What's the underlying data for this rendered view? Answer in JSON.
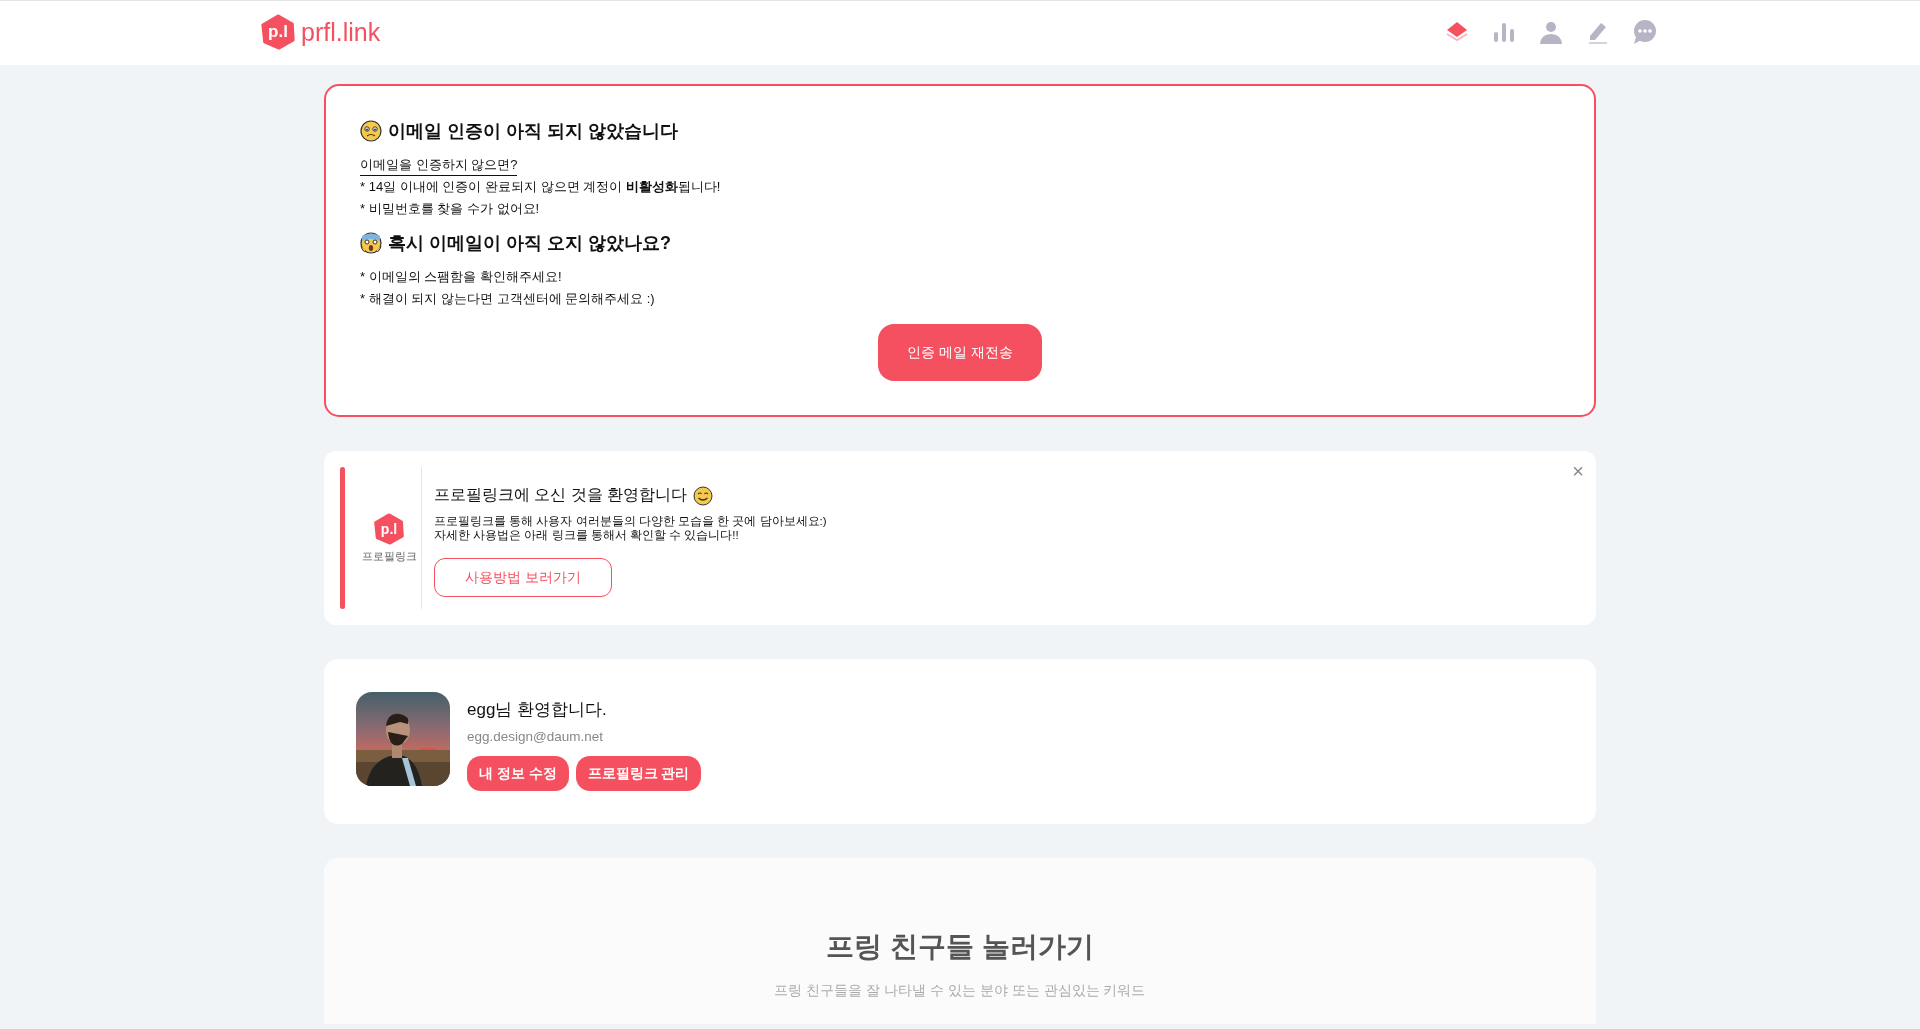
{
  "header": {
    "logo_mark": "p.l",
    "logo_text": "prfl.link",
    "nav": [
      {
        "kind": "layers",
        "selected": true
      },
      {
        "kind": "chart",
        "selected": false
      },
      {
        "kind": "user",
        "selected": false
      },
      {
        "kind": "edit",
        "selected": false
      },
      {
        "kind": "chat",
        "selected": false
      }
    ]
  },
  "verification_notice": {
    "title": "이메일 인증이 아직 되지 않았습니다",
    "subtitle": "이메일을 인증하지 않으면?",
    "notes": [
      "* 14일 이내에 인증이 완료되지 않으면 계정이 **비활성화**됩니다!",
      "* 비밀번호를 찾을 수가 없어요!"
    ],
    "title_2": "혹시 이메일이 아직 오지 않았나요?",
    "notes_2": [
      "* 이메일의 스팸함을 확인해주세요!",
      "* 해결이 되지 않는다면 고객센터에 문의해주세요 :)"
    ],
    "button": "인증 메일 재전송"
  },
  "welcome": {
    "logo_mark": "p.l",
    "brand_label": "프로필링크",
    "title": "프로필링크에 오신 것을 환영합니다",
    "lines": [
      "프로필링크를 통해 사용자 여러분들의 다양한 모습을 한 곳에 담아보세요:)",
      "자세한 사용법은 아래 링크를 통해서 확인할 수 있습니다!!"
    ],
    "button": "사용방법 보러가기",
    "close": "×"
  },
  "profile": {
    "greeting": "egg님 환영합니다.",
    "email": "egg.design@daum.net",
    "buttons": [
      "내 정보 수정",
      "프로필링크 관리"
    ]
  },
  "explore": {
    "title": "프링 친구들 놀러가기",
    "subtitle": "프링 친구들을 잘 나타낼 수 있는 분야 또는 관심있는 키워드"
  }
}
